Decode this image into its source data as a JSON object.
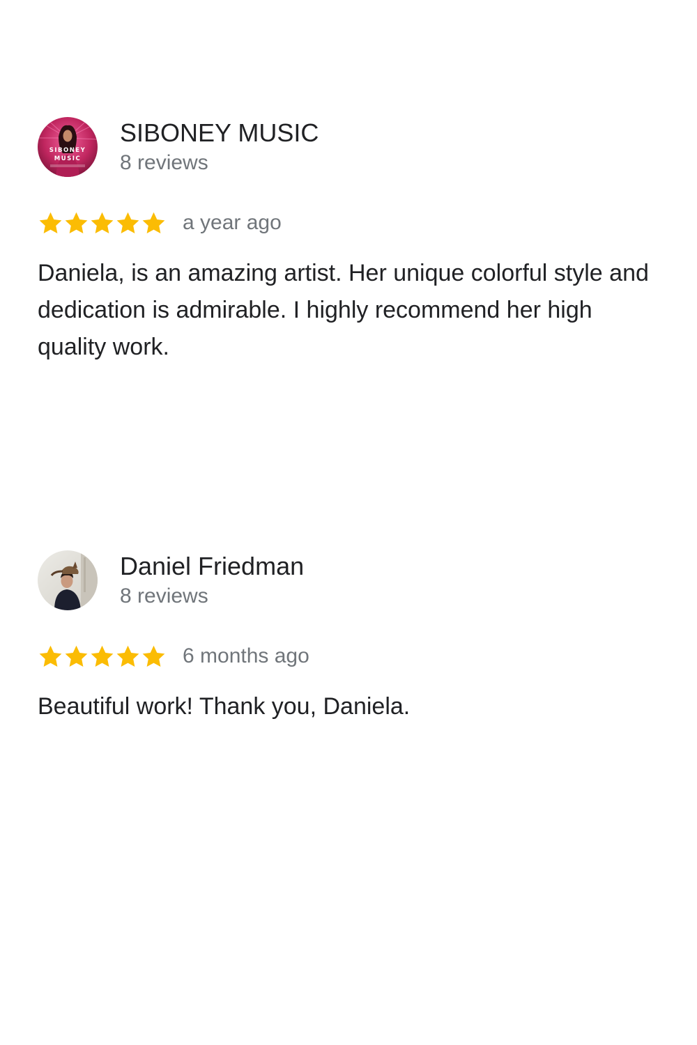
{
  "colors": {
    "star": "#fbbc04",
    "name_text": "#202124",
    "secondary_text": "#70757a",
    "background": "#ffffff"
  },
  "reviews": [
    {
      "author": "SIBONEY MUSIC",
      "review_count": "8 reviews",
      "rating": 5,
      "time": "a year ago",
      "text": "Daniela, is an amazing artist. Her unique colorful style and dedication is admirable. I highly recommend her high quality work.",
      "avatar": {
        "icon": "siboney-music-logo-avatar",
        "logo_line1": "SIBONEY",
        "logo_line2": "MUSIC"
      }
    },
    {
      "author": "Daniel Friedman",
      "review_count": "8 reviews",
      "rating": 5,
      "time": "6 months ago",
      "text": "Beautiful work! Thank you, Daniela.",
      "avatar": {
        "icon": "profile-photo-avatar"
      }
    }
  ]
}
